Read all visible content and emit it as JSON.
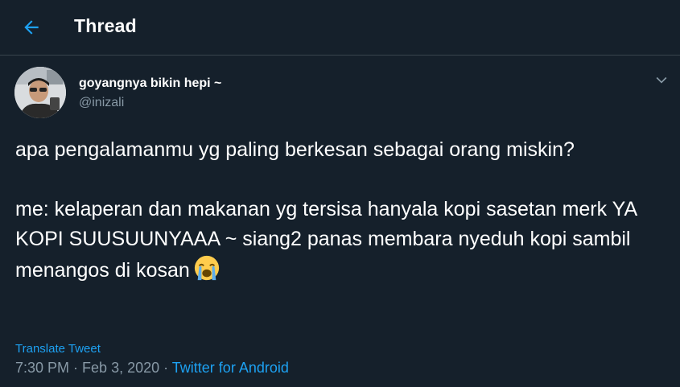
{
  "header": {
    "title": "Thread",
    "back_icon": "arrow-left-icon"
  },
  "colors": {
    "background": "#15202b",
    "accent": "#1da1f2",
    "muted_text": "#8899a6",
    "divider": "#38444d"
  },
  "tweet": {
    "author": {
      "display_name": "goyangnya bikin hepi ~",
      "handle": "@inizali"
    },
    "menu_icon": "chevron-down-icon",
    "paragraphs": [
      "apa pengalamanmu yg paling berkesan sebagai orang miskin?",
      "me: kelaperan dan makanan yg tersisa hanyala kopi sasetan merk YA KOPI SUUSUUNYAAA ~ siang2 panas membara nyeduh kopi sambil menangos di kosan"
    ],
    "trailing_emoji": "loudly-crying-face-icon",
    "translate_label": "Translate Tweet",
    "time": "7:30 PM",
    "separator": " · ",
    "date": "Feb 3, 2020",
    "source": "Twitter for Android"
  }
}
